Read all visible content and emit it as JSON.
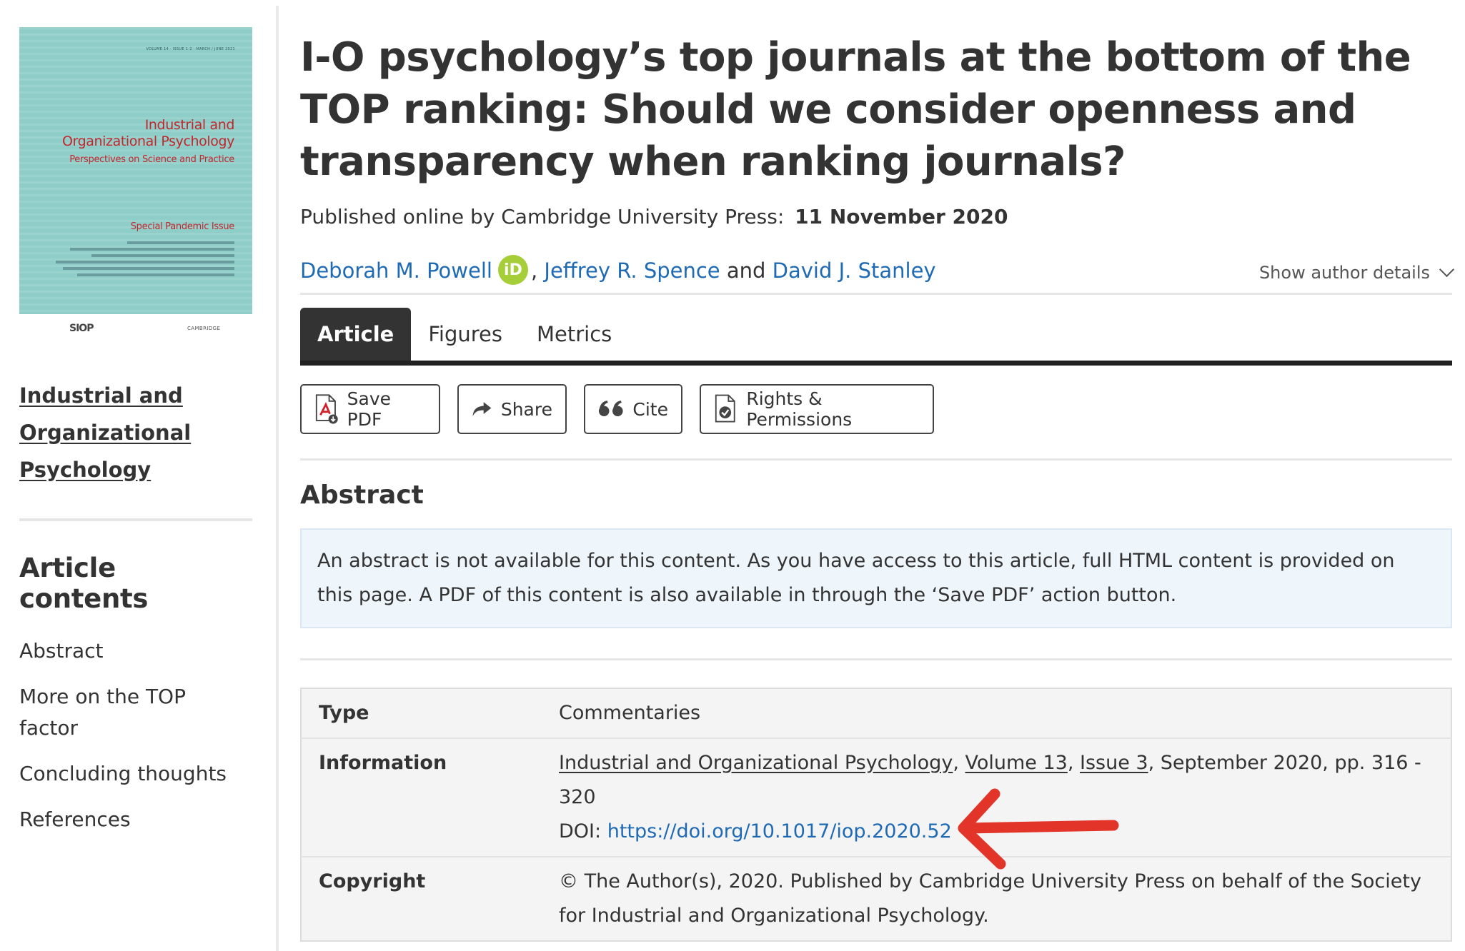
{
  "cover": {
    "volume_line": "VOLUME 14 · ISSUE 1-2 · MARCH / JUNE 2021",
    "title_line1": "Industrial and",
    "title_line2": "Organizational Psychology",
    "subtitle": "Perspectives on Science and Practice",
    "special": "Special Pandemic Issue",
    "siop_logo": "SIOP",
    "cup_logo": "CAMBRIDGE"
  },
  "sidebar": {
    "journal_link": "Industrial and Organizational Psychology",
    "contents_title": "Article contents",
    "contents": [
      "Abstract",
      "More on the TOP factor",
      "Concluding thoughts",
      "References"
    ]
  },
  "article": {
    "title": "I-O psychology’s top journals at the bottom of the TOP ranking: Should we consider openness and transparency when ranking journals?",
    "published_label": "Published online by Cambridge University Press:",
    "published_date": "11 November 2020",
    "authors": [
      "Deborah M. Powell",
      "Jeffrey R. Spence",
      "David J. Stanley"
    ],
    "author_sep_comma": ",",
    "author_sep_and": "and",
    "orcid_label": "iD",
    "show_author_details": "Show author details"
  },
  "tabs": [
    "Article",
    "Figures",
    "Metrics"
  ],
  "actions": {
    "save_pdf": "Save PDF",
    "share": "Share",
    "cite": "Cite",
    "rights": "Rights & Permissions"
  },
  "abstract": {
    "heading": "Abstract",
    "text": "An abstract is not available for this content. As you have access to this article, full HTML content is provided on this page. A PDF of this content is also available in through the ‘Save PDF’ action button."
  },
  "meta": {
    "type_label": "Type",
    "type_value": "Commentaries",
    "info_label": "Information",
    "journal": "Industrial and Organizational Psychology",
    "volume": "Volume 13",
    "issue": "Issue 3",
    "date_pages": ", September 2020, pp. 316 - 320",
    "doi_label": "DOI:",
    "doi": "https://doi.org/10.1017/iop.2020.52",
    "copyright_label": "Copyright",
    "copyright_value": "© The Author(s), 2020. Published by Cambridge University Press on behalf of the Society for Industrial and Organizational Psychology."
  },
  "annotation": {
    "arrow_color": "#e3342a",
    "arrow_target": "doi-link"
  }
}
